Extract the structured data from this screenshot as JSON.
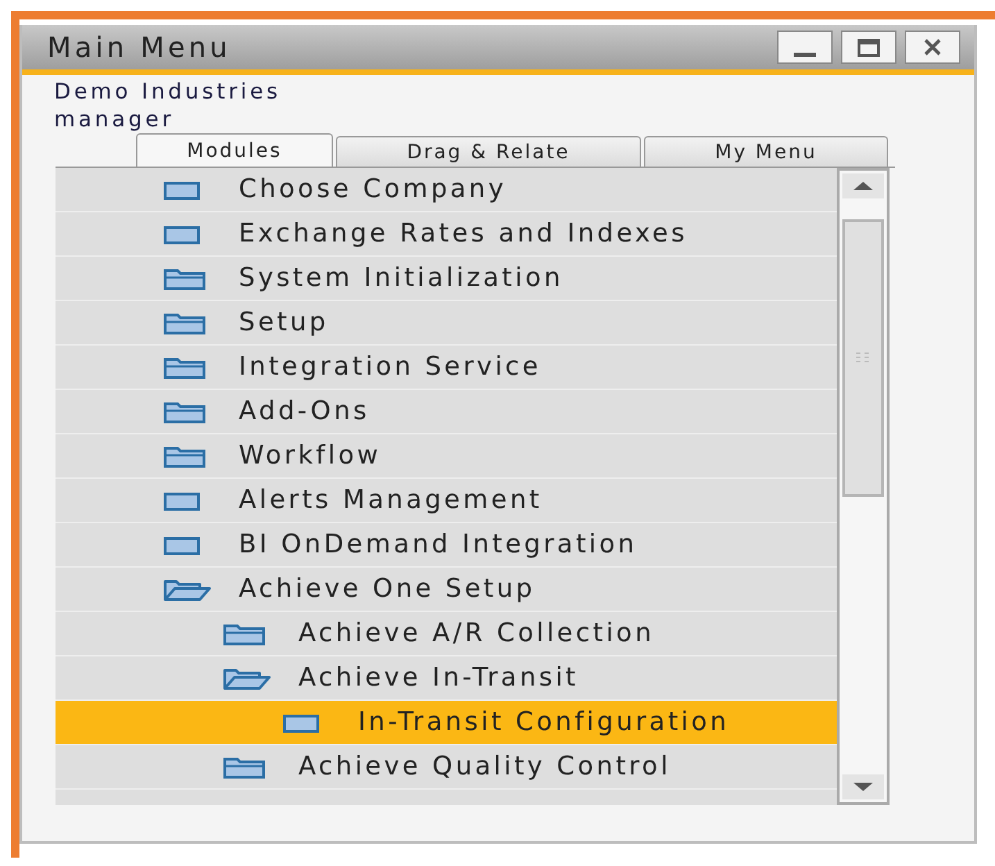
{
  "window": {
    "title": "Main Menu"
  },
  "company": "Demo Industries",
  "user": "manager",
  "tabs": [
    {
      "label": "Modules",
      "selected": true
    },
    {
      "label": "Drag & Relate",
      "selected": false
    },
    {
      "label": "My Menu",
      "selected": false
    }
  ],
  "tree": [
    {
      "label": "Choose Company",
      "kind": "form",
      "selected": false
    },
    {
      "label": "Exchange Rates and Indexes",
      "kind": "form",
      "selected": false
    },
    {
      "label": "System Initialization",
      "kind": "folder",
      "expanded": false,
      "selected": false
    },
    {
      "label": "Setup",
      "kind": "folder",
      "expanded": false,
      "selected": false
    },
    {
      "label": "Integration Service",
      "kind": "folder",
      "expanded": false,
      "selected": false
    },
    {
      "label": "Add-Ons",
      "kind": "folder",
      "expanded": false,
      "selected": false
    },
    {
      "label": "Workflow",
      "kind": "folder",
      "expanded": false,
      "selected": false
    },
    {
      "label": "Alerts Management",
      "kind": "form",
      "selected": false
    },
    {
      "label": "BI OnDemand Integration",
      "kind": "form",
      "selected": false
    },
    {
      "label": "Achieve One Setup",
      "kind": "folder",
      "expanded": true,
      "selected": false,
      "children": [
        {
          "label": "Achieve A/R Collection",
          "kind": "folder",
          "expanded": false,
          "selected": false
        },
        {
          "label": "Achieve In-Transit",
          "kind": "folder",
          "expanded": true,
          "selected": false,
          "children": [
            {
              "label": "In-Transit Configuration",
              "kind": "form",
              "selected": true
            }
          ]
        },
        {
          "label": "Achieve Quality Control",
          "kind": "folder",
          "expanded": false,
          "selected": false
        }
      ]
    }
  ]
}
